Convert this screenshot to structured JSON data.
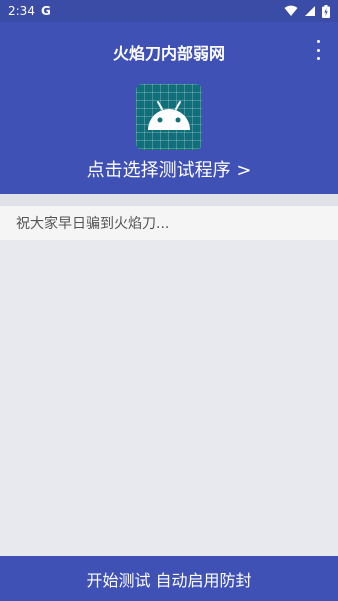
{
  "status_bar": {
    "time": "2:34",
    "app_badge": "G"
  },
  "app_bar": {
    "title": "火焰刀内部弱网"
  },
  "header": {
    "select_program_label": "点击选择测试程序 >"
  },
  "notice": {
    "text": "祝大家早日骗到火焰刀..."
  },
  "bottom_action": {
    "label": "开始测试 自动启用防封"
  },
  "colors": {
    "primary": "#3f51b5",
    "status_bar": "#3a4ca6",
    "background": "#e8e9ee",
    "app_icon_bg": "#0f6f7a"
  }
}
